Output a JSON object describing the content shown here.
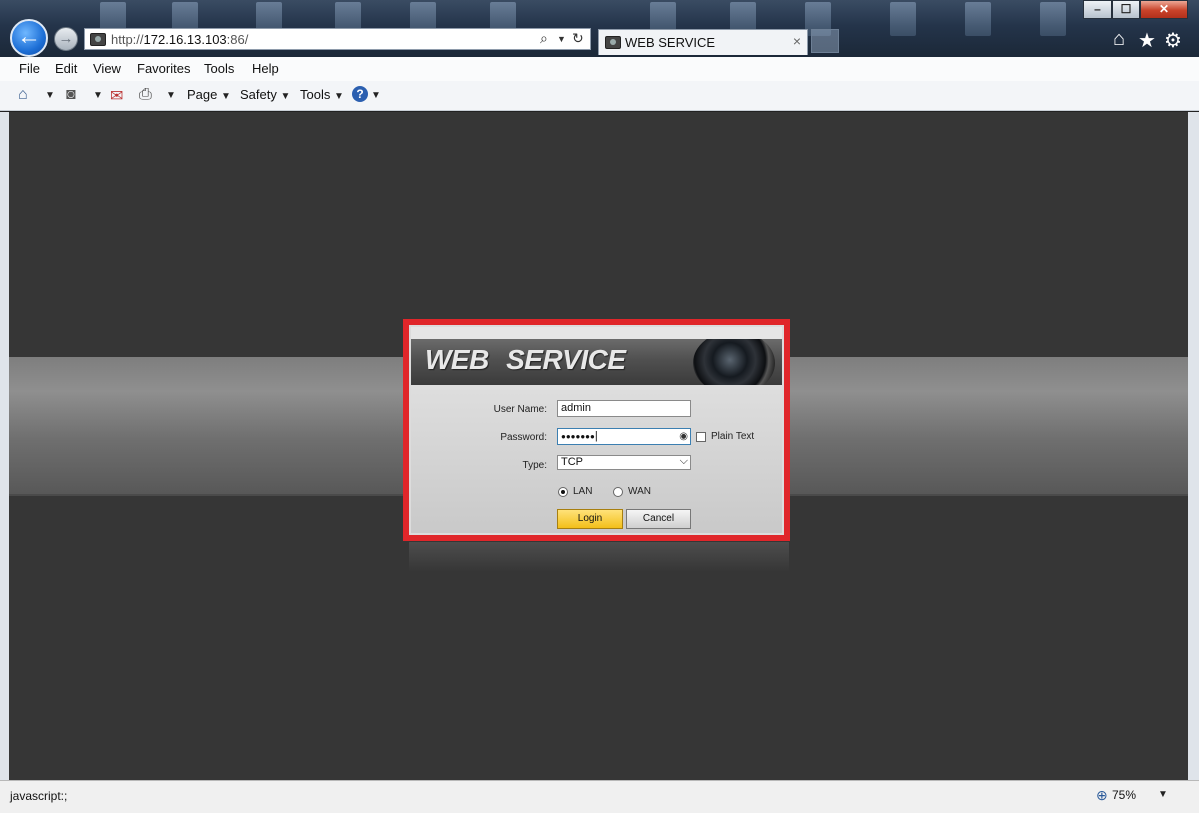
{
  "window": {
    "minimize": "–",
    "maximize": "☐",
    "close": "✕"
  },
  "address_bar": {
    "url_prefix": "http://",
    "url_host": "172.16.13.103",
    "url_port": ":86/"
  },
  "tab": {
    "title": "WEB SERVICE",
    "close": "×"
  },
  "menu": [
    "File",
    "Edit",
    "View",
    "Favorites",
    "Tools",
    "Help"
  ],
  "commandbar": {
    "page": "Page",
    "safety": "Safety",
    "tools": "Tools"
  },
  "login": {
    "banner_title": "WEB  SERVICE",
    "username_label": "User Name:",
    "username_value": "admin",
    "password_label": "Password:",
    "password_value": "●●●●●●●",
    "plain_text_label": "Plain Text",
    "type_label": "Type:",
    "type_value": "TCP",
    "lan_label": "LAN",
    "wan_label": "WAN",
    "network_selected": "LAN",
    "login_button": "Login",
    "cancel_button": "Cancel"
  },
  "status": {
    "text": "javascript:;",
    "zoom": "75%"
  },
  "colors": {
    "highlight_frame": "#e0262a",
    "login_button": "#f3bf1a",
    "content_background": "#363636"
  }
}
